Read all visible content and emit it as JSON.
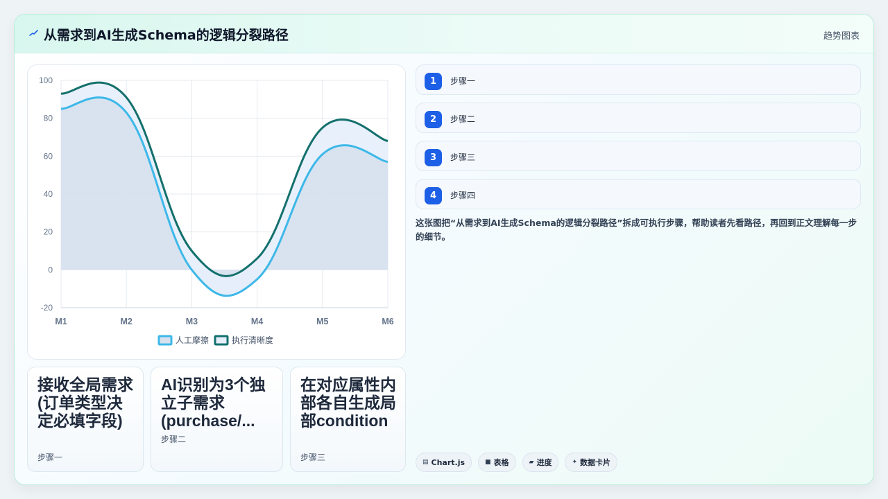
{
  "header": {
    "icon": "pulse-icon",
    "title": "从需求到AI生成Schema的逻辑分裂路径",
    "tag": "趋势图表"
  },
  "chart_data": {
    "type": "area",
    "categories": [
      "M1",
      "M2",
      "M3",
      "M4",
      "M5",
      "M6"
    ],
    "ylim": [
      -20,
      100
    ],
    "yticks": [
      -20,
      0,
      20,
      40,
      60,
      80,
      100
    ],
    "grid": true,
    "legend_position": "bottom",
    "series": [
      {
        "name": "人工摩擦",
        "values": [
          85,
          83,
          0,
          -5,
          61,
          57
        ],
        "color": "#3db8e8",
        "fill": "#d7e1ee"
      },
      {
        "name": "执行清晰度",
        "values": [
          93,
          91,
          10,
          6,
          75,
          68
        ],
        "color": "#13706c",
        "fill": "#e6eefb"
      }
    ]
  },
  "cards": [
    {
      "title": "接收全局需求(订单类型决定必填字段)",
      "sub": "步骤一",
      "color": "#12706c"
    },
    {
      "title": "AI识别为3个独立子需求(purchase/...",
      "sub": "步骤二",
      "color": "#14b06e"
    },
    {
      "title": "在对应属性内部各自生成局部condition",
      "sub": "步骤三",
      "color": "#43b9e6"
    }
  ],
  "steps": [
    {
      "num": "1",
      "label": "步骤一"
    },
    {
      "num": "2",
      "label": "步骤二"
    },
    {
      "num": "3",
      "label": "步骤三"
    },
    {
      "num": "4",
      "label": "步骤四"
    }
  ],
  "description": "这张图把“从需求到AI生成Schema的逻辑分裂路径”拆成可执行步骤，帮助读者先看路径，再回到正文理解每一步的细节。",
  "chips": [
    {
      "icon": "chart-icon",
      "glyph": "▤",
      "label": "Chart.js"
    },
    {
      "icon": "table-icon",
      "glyph": "■",
      "label": "表格"
    },
    {
      "icon": "progress-icon",
      "glyph": "▰",
      "label": "进度"
    },
    {
      "icon": "sparkle-icon",
      "glyph": "✦",
      "label": "数据卡片"
    }
  ]
}
